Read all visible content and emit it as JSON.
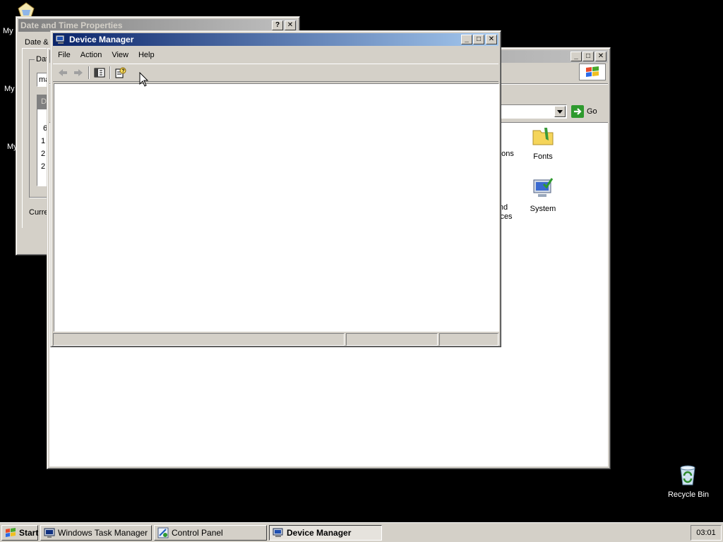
{
  "desktop": {
    "icons": [
      {
        "label": "My"
      },
      {
        "label": "My"
      },
      {
        "label": "My"
      }
    ],
    "recycle_bin": "Recycle Bin"
  },
  "date_time_window": {
    "title": "Date and Time Properties",
    "tab_label": "Date &",
    "group_label": "Dat",
    "month_value": "ma",
    "calendar_header": "D",
    "calendar_days": [
      "6",
      "1",
      "2",
      "2"
    ],
    "current_label": "Curre"
  },
  "control_panel_window": {
    "address_go": "Go",
    "items": [
      {
        "label": "ons"
      },
      {
        "label": "Fonts"
      },
      {
        "label": "nd"
      },
      {
        "label": "ces"
      },
      {
        "label": "System"
      }
    ]
  },
  "device_manager": {
    "title": "Device Manager",
    "menu": [
      "File",
      "Action",
      "View",
      "Help"
    ]
  },
  "taskbar": {
    "start": "Start",
    "buttons": [
      "Windows Task Manager",
      "Control Panel",
      "Device Manager"
    ],
    "clock": "03:01"
  }
}
